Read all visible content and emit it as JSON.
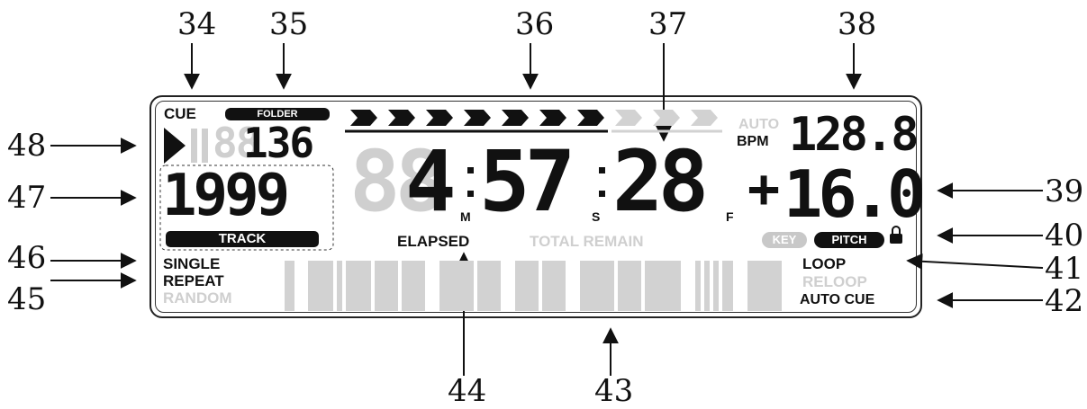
{
  "callouts": {
    "n34": "34",
    "n35": "35",
    "n36": "36",
    "n37": "37",
    "n38": "38",
    "n39": "39",
    "n40": "40",
    "n41": "41",
    "n42": "42",
    "n43": "43",
    "n44": "44",
    "n45": "45",
    "n46": "46",
    "n47": "47",
    "n48": "48"
  },
  "display": {
    "cue": "CUE",
    "folder": "FOLDER",
    "track_ghost": "88",
    "track_number": "136",
    "folder_ghost": "888",
    "folder_number": "1999",
    "track": "TRACK",
    "time_min_ghost": "88",
    "time_min": "4",
    "time_sec_ghost": "88",
    "time_sec": "57",
    "time_frame": "28",
    "unit_m": "M",
    "unit_s": "S",
    "unit_f": "F",
    "elapsed": "ELAPSED",
    "total_remain": "TOTAL REMAIN",
    "auto": "AUTO",
    "bpm": "BPM",
    "bpm_ghost": "1",
    "bpm_value": "128.8",
    "pitch_ghost": "88",
    "pitch_sign": "+",
    "pitch_value": "16.0",
    "key": "KEY",
    "pitch": "PITCH",
    "single": "SINGLE",
    "repeat": "REPEAT",
    "random": "RANDOM",
    "loop": "LOOP",
    "reloop": "RELOOP",
    "auto_cue": "AUTO CUE"
  },
  "colors": {
    "active": "#111111",
    "inactive": "#cfcfcf",
    "background": "#ffffff"
  },
  "icons": {
    "play": "play-triangle-icon",
    "lock": "lock-icon"
  }
}
